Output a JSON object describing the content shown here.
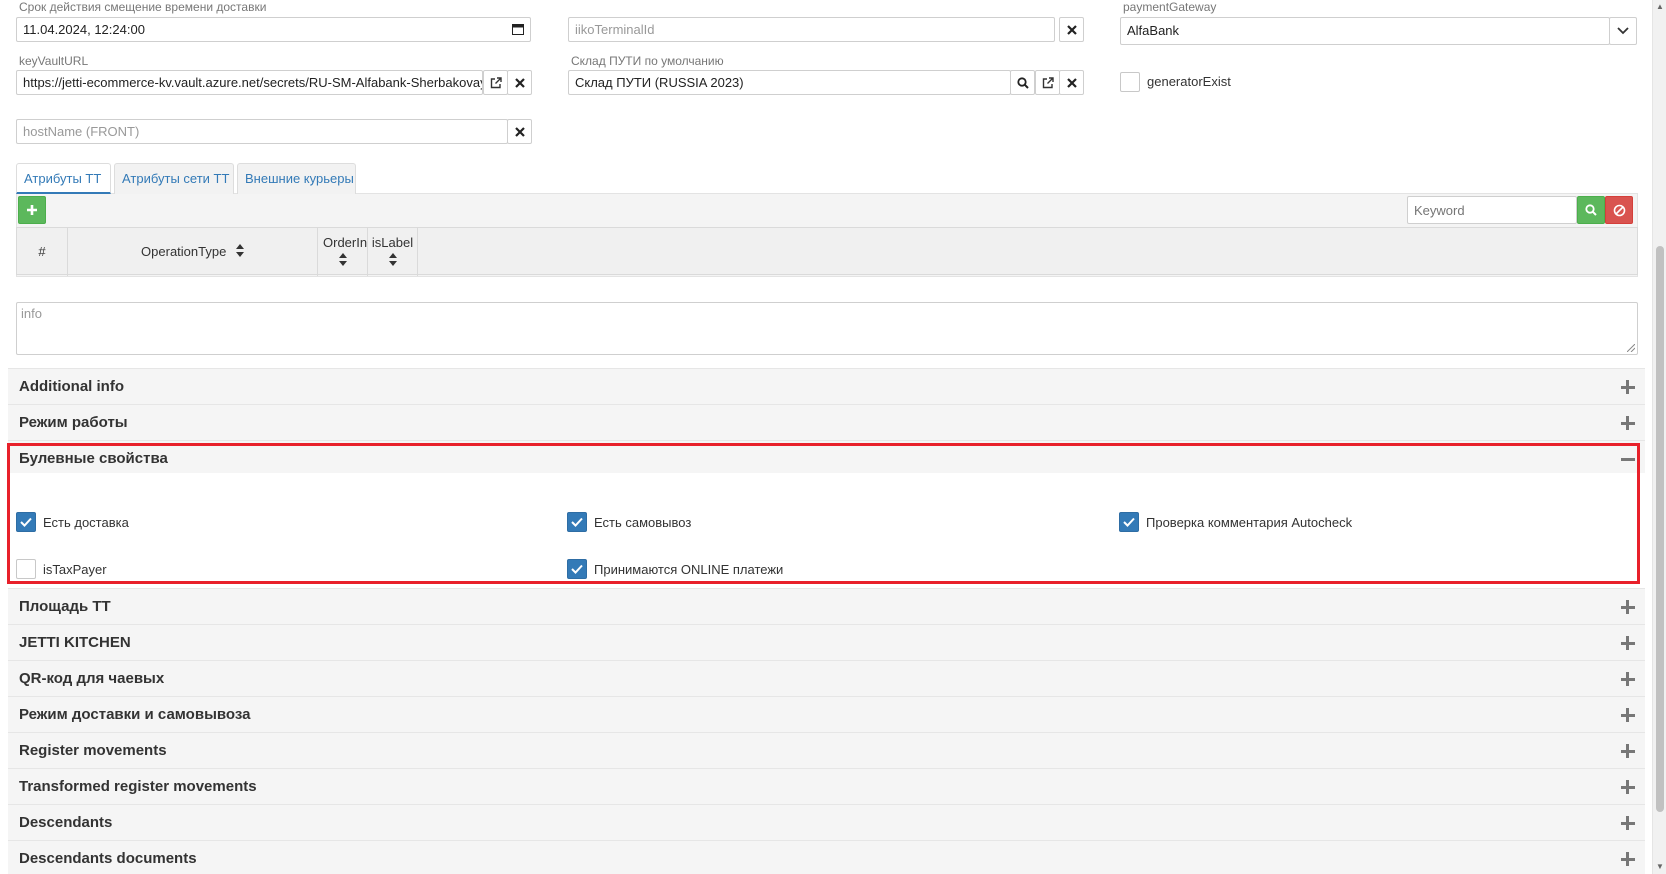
{
  "form": {
    "delivery_offset": {
      "label": "Срок действия смещение времени доставки",
      "value": "11.04.2024, 12:24:00"
    },
    "iiko_terminal": {
      "placeholder": "iikoTerminalId"
    },
    "payment_gateway": {
      "label": "paymentGateway",
      "value": "AlfaBank"
    },
    "key_vault": {
      "label": "keyVaultURL",
      "value": "https://jetti-ecommerce-kv.vault.azure.net/secrets/RU-SM-Alfabank-Sherbakovay"
    },
    "warehouse": {
      "label": "Склад ПУТИ по умолчанию",
      "value": "Склад ПУТИ (RUSSIA 2023)"
    },
    "generator_exist": {
      "label": "generatorExist",
      "checked": false
    },
    "host_name": {
      "placeholder": "hostName (FRONT)"
    }
  },
  "tabs": [
    {
      "label": "Атрибуты ТТ",
      "active": true
    },
    {
      "label": "Атрибуты сети ТТ",
      "active": false
    },
    {
      "label": "Внешние курьеры",
      "active": false
    }
  ],
  "toolbar": {
    "keyword_placeholder": "Keyword"
  },
  "grid": {
    "columns": [
      "#",
      "OperationType",
      "OrderIndex",
      "isLabel"
    ]
  },
  "info": {
    "placeholder": "info"
  },
  "accordion": {
    "additional_info": "Additional info",
    "work_mode": "Режим работы",
    "boolean_props": "Булевные свойства",
    "area": "Площадь ТТ",
    "jetti_kitchen": "JETTI KITCHEN",
    "qr_tips": "QR-код для чаевых",
    "delivery_mode": "Режим доставки и самовывоза",
    "register_movements": "Register movements",
    "transformed_register_movements": "Transformed register movements",
    "descendants": "Descendants",
    "descendants_documents": "Descendants documents"
  },
  "booleans": {
    "has_delivery": {
      "label": "Есть доставка",
      "checked": true
    },
    "has_pickup": {
      "label": "Есть самовывоз",
      "checked": true
    },
    "autocheck_comment": {
      "label": "Проверка комментария Autocheck",
      "checked": true
    },
    "is_tax_payer": {
      "label": "isTaxPayer",
      "checked": false
    },
    "online_payments": {
      "label": "Принимаются ONLINE платежи",
      "checked": true
    }
  },
  "colors": {
    "accent": "#337ab7",
    "add": "#5cb85c",
    "clear": "#d9534f",
    "highlight": "#e8202a"
  }
}
